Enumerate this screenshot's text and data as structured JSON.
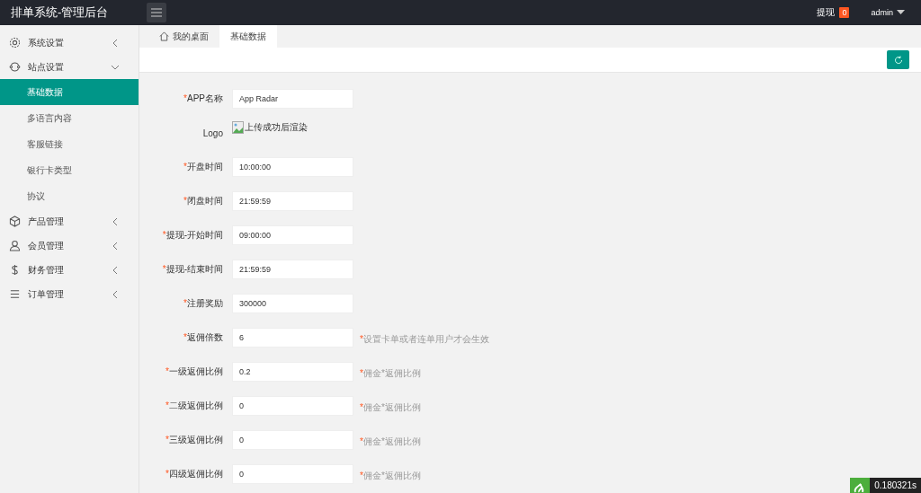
{
  "header": {
    "title": "排单系统-管理后台",
    "withdraw_label": "提现",
    "withdraw_count": "0",
    "user": "admin"
  },
  "sidebar": {
    "items": [
      {
        "label": "系统设置",
        "expanded": false
      },
      {
        "label": "站点设置",
        "expanded": true,
        "children": [
          {
            "label": "基础数据",
            "selected": true
          },
          {
            "label": "多语言内容",
            "selected": false
          },
          {
            "label": "客服链接",
            "selected": false
          },
          {
            "label": "银行卡类型",
            "selected": false
          },
          {
            "label": "协议",
            "selected": false
          }
        ]
      },
      {
        "label": "产品管理",
        "expanded": false
      },
      {
        "label": "会员管理",
        "expanded": false
      },
      {
        "label": "财务管理",
        "expanded": false
      },
      {
        "label": "订单管理",
        "expanded": false
      }
    ]
  },
  "tabs": [
    {
      "label": "我的桌面",
      "selected": false
    },
    {
      "label": "基础数据",
      "selected": true
    }
  ],
  "form": {
    "fields": [
      {
        "kind": "input",
        "mark": "*",
        "label": "APP名称",
        "value": "App Radar"
      },
      {
        "kind": "image",
        "label": "Logo",
        "alt": "上传成功后渲染"
      },
      {
        "kind": "input",
        "mark": "*",
        "label": "开盘时间",
        "value": "10:00:00"
      },
      {
        "kind": "input",
        "mark": "*",
        "label": "闭盘时间",
        "value": "21:59:59"
      },
      {
        "kind": "input",
        "mark": "*",
        "label": "提现-开始时间",
        "value": "09:00:00"
      },
      {
        "kind": "input",
        "mark": "*",
        "label": "提现-结束时间",
        "value": "21:59:59"
      },
      {
        "kind": "input",
        "mark": "*",
        "label": "注册奖励",
        "value": "300000"
      },
      {
        "kind": "input",
        "mark": "*",
        "label": "返佣倍数",
        "value": "6",
        "hint_mark": "*",
        "hint": "设置卡单或者连单用户才会生效"
      },
      {
        "kind": "input",
        "mark": "*",
        "label": "一级返佣比例",
        "value": "0.2",
        "hint_mark": "*",
        "hint": "佣金*返佣比例"
      },
      {
        "kind": "input",
        "mark": "*",
        "label": "二级返佣比例",
        "value": "0",
        "hint_mark": "*",
        "hint": "佣金*返佣比例"
      },
      {
        "kind": "input",
        "mark": "*",
        "label": "三级返佣比例",
        "value": "0",
        "hint_mark": "*",
        "hint": "佣金*返佣比例"
      },
      {
        "kind": "input",
        "mark": "*",
        "label": "四级返佣比例",
        "value": "0",
        "hint_mark": "*",
        "hint": "佣金*返佣比例"
      }
    ]
  },
  "trace": {
    "time": "0.180321s"
  }
}
